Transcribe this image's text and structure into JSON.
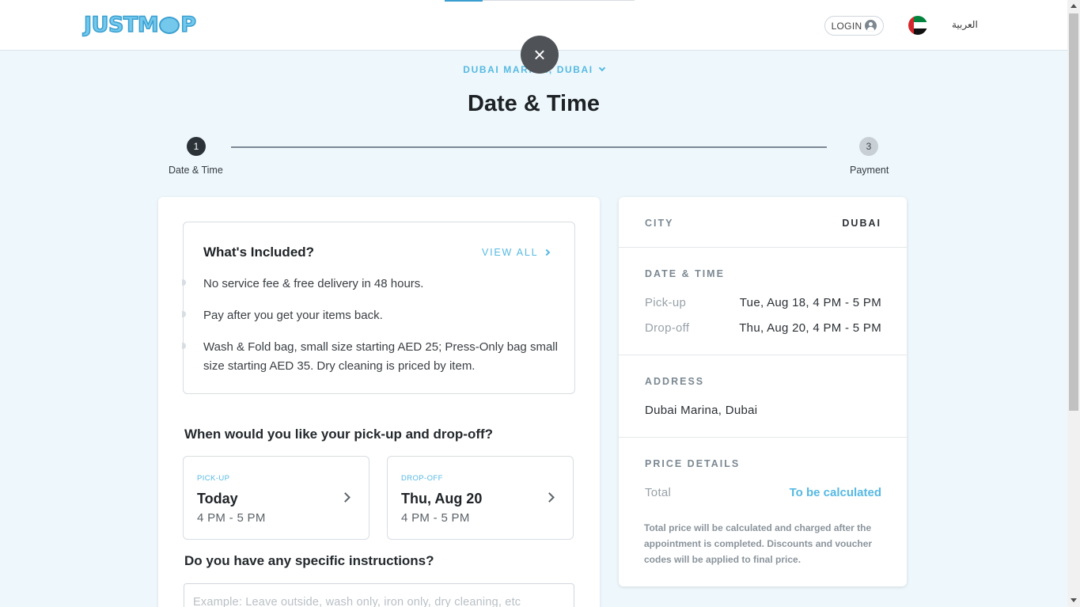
{
  "header": {
    "logo_text": "JUSTMOP",
    "login_label": "LOGIN",
    "language_label": "العربية",
    "flag": "uae-flag-icon"
  },
  "close_icon": "×",
  "location": "DUBAI MARINA, DUBAI",
  "page_title": "Date & Time",
  "stepper": [
    {
      "number": "1",
      "label": "Date & Time",
      "state": "active"
    },
    {
      "number": "3",
      "label": "Payment",
      "state": "inactive"
    }
  ],
  "included": {
    "title": "What's Included?",
    "view_all": "VIEW ALL",
    "items": [
      "No service fee & free delivery in 48 hours.",
      "Pay after you get your items back.",
      "Wash & Fold bag, small size starting AED 25; Press-Only bag small size starting AED 35. Dry cleaning is priced by item."
    ]
  },
  "schedule": {
    "question": "When would you like your pick-up and drop-off?",
    "pickup": {
      "tag": "PICK-UP",
      "day": "Today",
      "time": "4 PM - 5 PM"
    },
    "dropoff": {
      "tag": "DROP-OFF",
      "day": "Thu, Aug 20",
      "time": "4 PM - 5 PM"
    }
  },
  "instructions": {
    "question": "Do you have any specific instructions?",
    "placeholder": "Example: Leave outside, wash only, iron only, dry cleaning, etc"
  },
  "summary": {
    "city_label": "CITY",
    "city_value": "DUBAI",
    "datetime_label": "DATE & TIME",
    "pickup_key": "Pick-up",
    "pickup_value": "Tue, Aug 18, 4 PM - 5 PM",
    "dropoff_key": "Drop-off",
    "dropoff_value": "Thu, Aug 20, 4 PM - 5 PM",
    "address_label": "ADDRESS",
    "address_value": "Dubai Marina, Dubai",
    "price_label": "PRICE DETAILS",
    "total_key": "Total",
    "total_value": "To be calculated",
    "note": "Total price will be calculated and charged after the appointment is completed. Discounts and voucher codes will be applied to final price."
  },
  "colors": {
    "accent": "#56b9e2",
    "dark": "#2c3338",
    "background": "#eef8fc"
  }
}
